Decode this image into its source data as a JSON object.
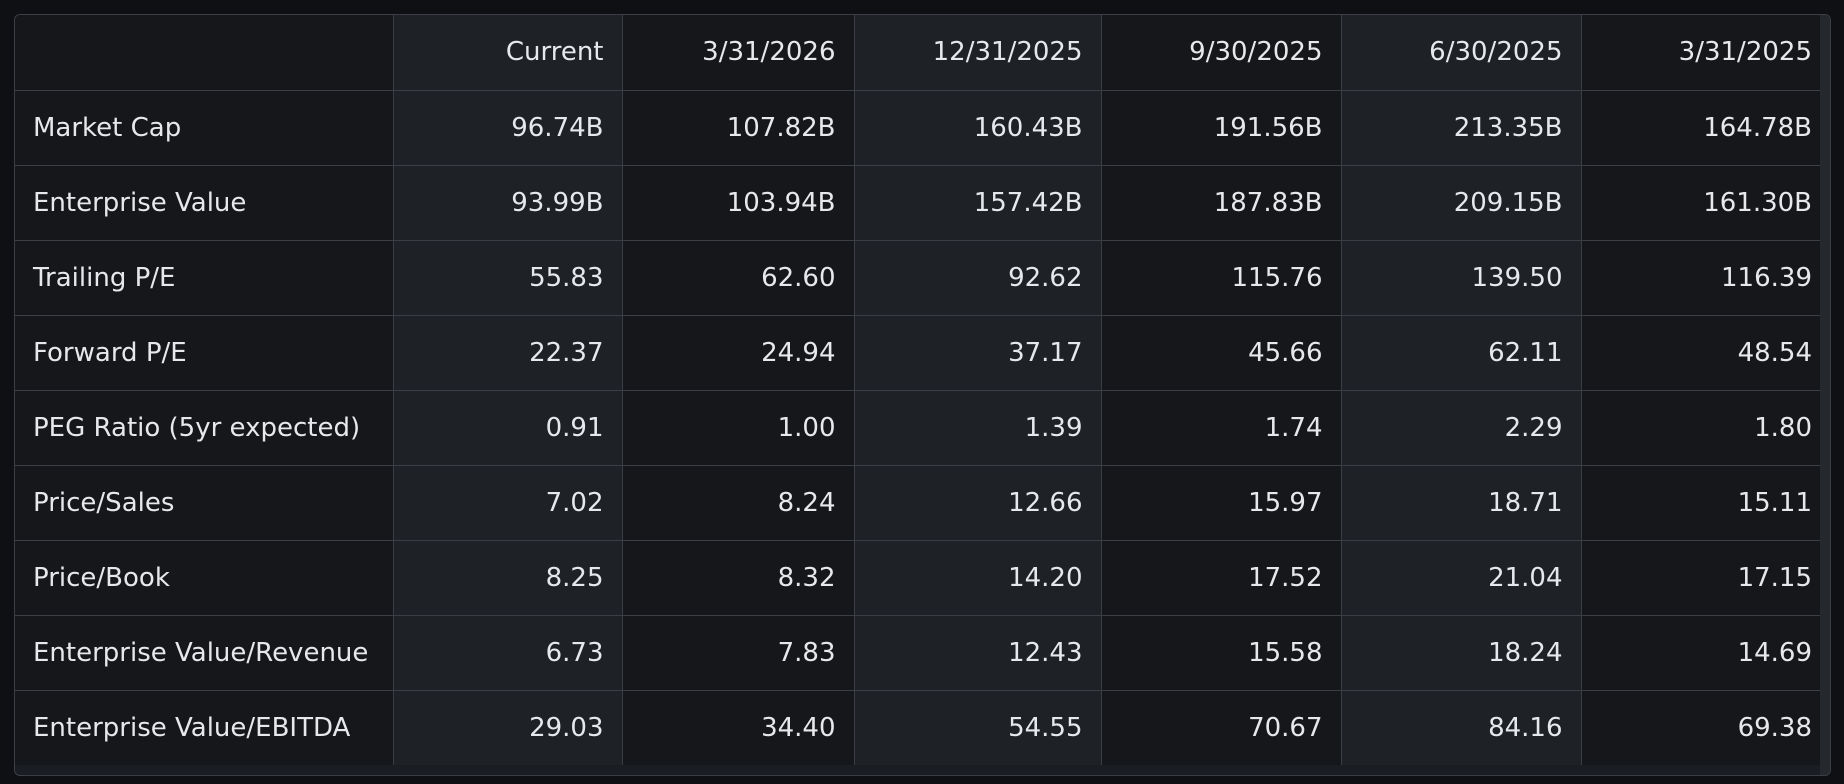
{
  "table": {
    "corner_label": "",
    "columns": [
      "Current",
      "3/31/2026",
      "12/31/2025",
      "9/30/2025",
      "6/30/2025",
      "3/31/2025"
    ],
    "rows": [
      {
        "label": "Market Cap",
        "values": [
          "96.74B",
          "107.82B",
          "160.43B",
          "191.56B",
          "213.35B",
          "164.78B"
        ]
      },
      {
        "label": "Enterprise Value",
        "values": [
          "93.99B",
          "103.94B",
          "157.42B",
          "187.83B",
          "209.15B",
          "161.30B"
        ]
      },
      {
        "label": "Trailing P/E",
        "values": [
          "55.83",
          "62.60",
          "92.62",
          "115.76",
          "139.50",
          "116.39"
        ]
      },
      {
        "label": "Forward P/E",
        "values": [
          "22.37",
          "24.94",
          "37.17",
          "45.66",
          "62.11",
          "48.54"
        ]
      },
      {
        "label": "PEG Ratio (5yr expected)",
        "values": [
          "0.91",
          "1.00",
          "1.39",
          "1.74",
          "2.29",
          "1.80"
        ]
      },
      {
        "label": "Price/Sales",
        "values": [
          "7.02",
          "8.24",
          "12.66",
          "15.97",
          "18.71",
          "15.11"
        ]
      },
      {
        "label": "Price/Book",
        "values": [
          "8.25",
          "8.32",
          "14.20",
          "17.52",
          "21.04",
          "17.15"
        ]
      },
      {
        "label": "Enterprise Value/Revenue",
        "values": [
          "6.73",
          "7.83",
          "12.43",
          "15.58",
          "18.24",
          "14.69"
        ]
      },
      {
        "label": "Enterprise Value/EBITDA",
        "values": [
          "29.03",
          "34.40",
          "54.55",
          "70.67",
          "84.16",
          "69.38"
        ]
      }
    ]
  },
  "colors": {
    "page_background": "#0e1013",
    "cell_dark": "#15171b",
    "cell_light": "#1e2126",
    "border": "#3b3f45",
    "text": "#e6e8eb"
  }
}
